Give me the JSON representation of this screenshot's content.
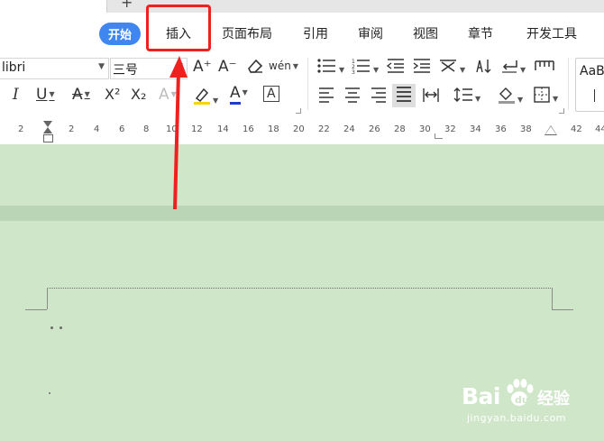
{
  "menu_tabs": [
    {
      "label": "开始",
      "active": true
    },
    {
      "label": "插入",
      "active": false
    },
    {
      "label": "页面布局",
      "active": false
    },
    {
      "label": "引用",
      "active": false
    },
    {
      "label": "审阅",
      "active": false
    },
    {
      "label": "视图",
      "active": false
    },
    {
      "label": "章节",
      "active": false
    },
    {
      "label": "开发工具",
      "active": false
    }
  ],
  "ribbon": {
    "font_name": "libri",
    "font_size": "三号",
    "grow_font": "A⁺",
    "shrink_font": "A⁻",
    "pinyin": "wén",
    "italic": "I",
    "underline": "U",
    "strike": "A",
    "superscript": "X²",
    "subscript": "X₂",
    "text_effect": "A",
    "font_color": "A",
    "char_border": "A",
    "style_preview": "AaB"
  },
  "ruler": {
    "numbers": [
      "2",
      "2",
      "4",
      "6",
      "8",
      "10",
      "12",
      "14",
      "16",
      "18",
      "20",
      "22",
      "24",
      "26",
      "28",
      "30",
      "32",
      "34",
      "36",
      "38",
      "42",
      "44"
    ]
  },
  "annotation": {
    "highlighted_tab": "插入",
    "color": "#ee2020"
  },
  "watermark": {
    "brand": "Bai",
    "brand_suffix": "经验",
    "url": "jingyan.baidu.com"
  },
  "colors": {
    "active_tab": "#3f86f0",
    "document_bg": "#cfe6c9",
    "highlight_yellow": "#f5d400",
    "font_color_blue": "#1e3ccf"
  }
}
